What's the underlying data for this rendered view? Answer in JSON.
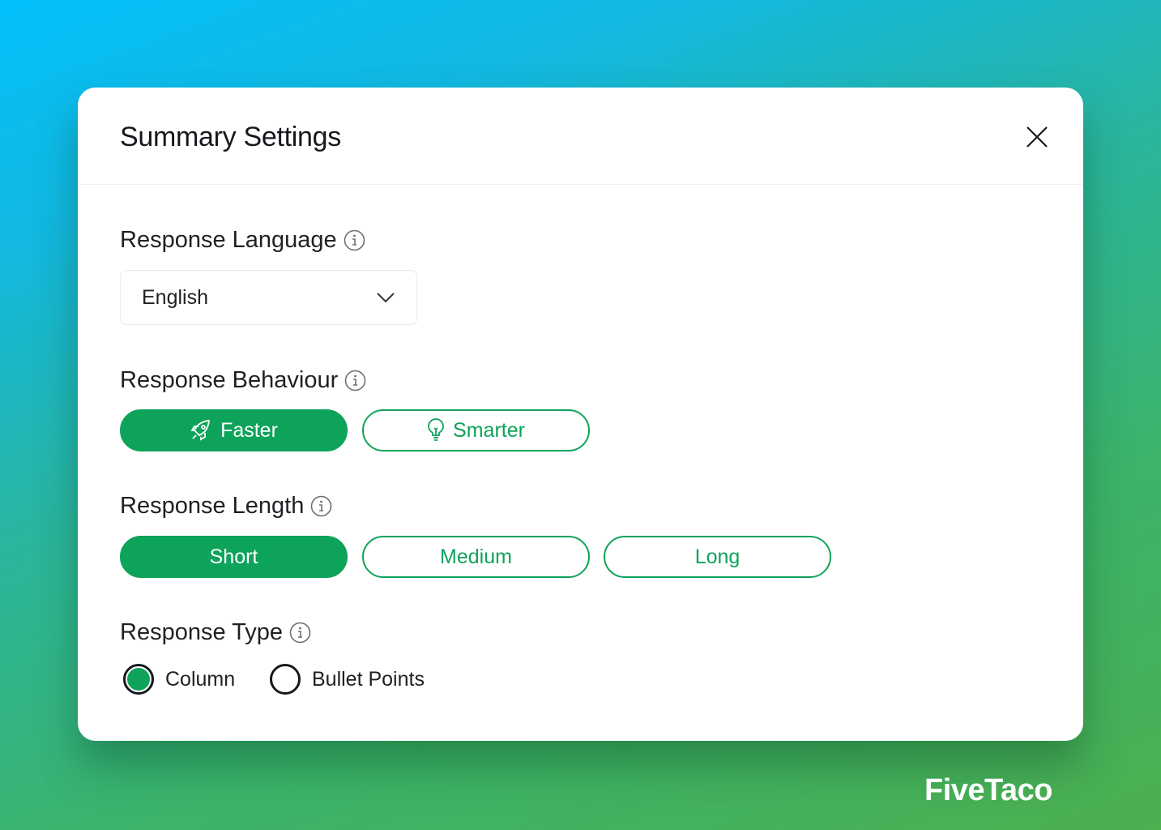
{
  "dialog": {
    "title": "Summary Settings",
    "close_icon": "close-icon"
  },
  "language": {
    "label": "Response Language",
    "value": "English"
  },
  "behaviour": {
    "label": "Response Behaviour",
    "options": [
      {
        "label": "Faster",
        "icon": "rocket-icon",
        "selected": true
      },
      {
        "label": "Smarter",
        "icon": "lightbulb-icon",
        "selected": false
      }
    ]
  },
  "length": {
    "label": "Response Length",
    "options": [
      {
        "label": "Short",
        "selected": true
      },
      {
        "label": "Medium",
        "selected": false
      },
      {
        "label": "Long",
        "selected": false
      }
    ]
  },
  "type": {
    "label": "Response Type",
    "options": [
      {
        "label": "Column",
        "selected": true
      },
      {
        "label": "Bullet Points",
        "selected": false
      }
    ]
  },
  "colors": {
    "accent": "#0ea35a"
  },
  "brand": "FiveTaco"
}
